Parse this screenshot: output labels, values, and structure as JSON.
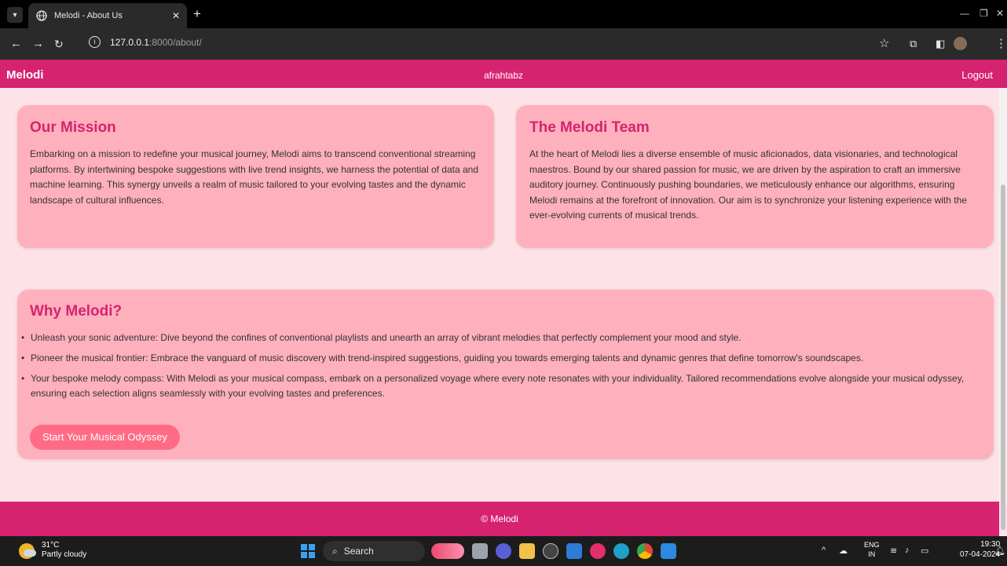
{
  "browser": {
    "tab_title": "Melodi - About Us",
    "url_host": "127.0.0.1",
    "url_path": ":8000/about/"
  },
  "navbar": {
    "brand": "Melodi",
    "username": "afrahtabz",
    "logout": "Logout"
  },
  "mission": {
    "title": "Our Mission",
    "text": "Embarking on a mission to redefine your musical journey, Melodi aims to transcend conventional streaming platforms. By intertwining bespoke suggestions with live trend insights, we harness the potential of data and machine learning. This synergy unveils a realm of music tailored to your evolving tastes and the dynamic landscape of cultural influences."
  },
  "team": {
    "title": "The Melodi Team",
    "text": "At the heart of Melodi lies a diverse ensemble of music aficionados, data visionaries, and technological maestros. Bound by our shared passion for music, we are driven by the aspiration to craft an immersive auditory journey. Continuously pushing boundaries, we meticulously enhance our algorithms, ensuring Melodi remains at the forefront of innovation. Our aim is to synchronize your listening experience with the ever-evolving currents of musical trends."
  },
  "why": {
    "title": "Why Melodi?",
    "items": [
      "Unleash your sonic adventure: Dive beyond the confines of conventional playlists and unearth an array of vibrant melodies that perfectly complement your mood and style.",
      "Pioneer the musical frontier: Embrace the vanguard of music discovery with trend-inspired suggestions, guiding you towards emerging talents and dynamic genres that define tomorrow's soundscapes.",
      "Your bespoke melody compass: With Melodi as your musical compass, embark on a personalized voyage where every note resonates with your individuality. Tailored recommendations evolve alongside your musical odyssey, ensuring each selection aligns seamlessly with your evolving tastes and preferences."
    ],
    "cta": "Start Your Musical Odyssey"
  },
  "footer": {
    "text": "© Melodi"
  },
  "taskbar": {
    "temp": "31°C",
    "weather": "Partly cloudy",
    "search": "Search",
    "lang": "ENG",
    "region": "IN",
    "time": "19:30",
    "date": "07-04-2024"
  },
  "colors": {
    "brand": "#d6236f",
    "card": "#ffb0bd",
    "page_bg": "#fde3e8",
    "button": "#ff6b85"
  }
}
